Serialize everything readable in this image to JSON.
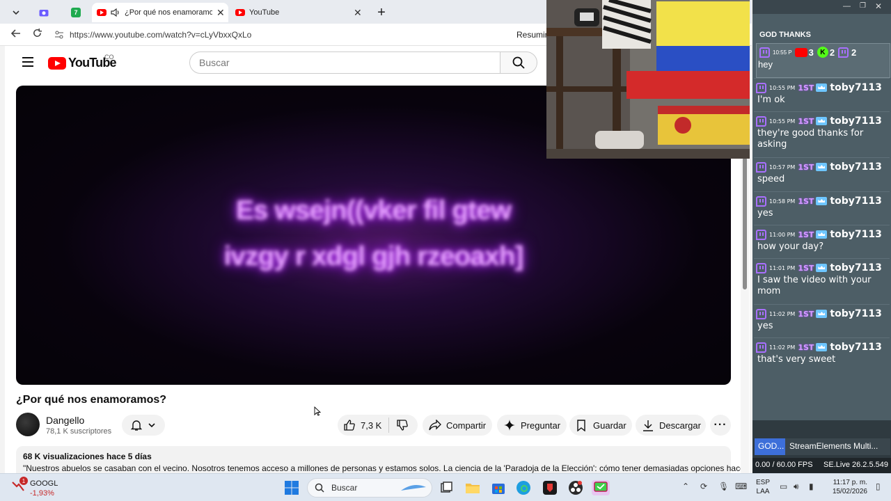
{
  "browser": {
    "tabs": [
      {
        "label": "¿Por qué nos enamoramos?",
        "active": true
      },
      {
        "label": "YouTube",
        "active": false
      }
    ],
    "badge_count": "7",
    "url": "https://www.youtube.com/watch?v=cLyVbxxQxLo",
    "summarize_label": "Resumir"
  },
  "youtube": {
    "logo_text": "YouTube",
    "country_code": "CO",
    "search_placeholder": "Buscar",
    "player_text_line1": "Es wsejn((vker fil gtew",
    "player_text_line2": "ivzgy r xdgl gjh rzeoaxh]",
    "video_title": "¿Por qué nos enamoramos?",
    "channel": {
      "name": "Dangello",
      "subscribers": "78,1 K suscriptores"
    },
    "actions": {
      "likes": "7,3 K",
      "share": "Compartir",
      "ask": "Preguntar",
      "save": "Guardar",
      "download": "Descargar"
    },
    "description": {
      "meta": "68 K visualizaciones  hace 5 días",
      "text": "\"Nuestros abuelos se casaban con el vecino. Nosotros tenemos acceso a millones de personas y estamos solos. La ciencia de la 'Paradoja de la Elección': cómo tener demasiadas opciones hace"
    }
  },
  "chat": {
    "header": "GOD THANKS",
    "first": {
      "time": "10:55 P",
      "text": "hey",
      "counts": [
        "3",
        "2",
        "2"
      ]
    },
    "messages": [
      {
        "time": "10:55 PM",
        "badge": "1ST",
        "user": "toby7113",
        "text": "I'm ok"
      },
      {
        "time": "10:55 PM",
        "badge": "1ST",
        "user": "toby7113",
        "text": "they're good thanks for asking"
      },
      {
        "time": "10:57 PM",
        "badge": "1ST",
        "user": "toby7113",
        "text": "speed"
      },
      {
        "time": "10:58 PM",
        "badge": "1ST",
        "user": "toby7113",
        "text": "yes"
      },
      {
        "time": "11:00 PM",
        "badge": "1ST",
        "user": "toby7113",
        "text": "how your day?"
      },
      {
        "time": "11:01 PM",
        "badge": "1ST",
        "user": "toby7113",
        "text": "I saw the video with your mom"
      },
      {
        "time": "11:02 PM",
        "badge": "1ST",
        "user": "toby7113",
        "text": "yes"
      },
      {
        "time": "11:02 PM",
        "badge": "1ST",
        "user": "toby7113",
        "text": "that's very sweet"
      }
    ],
    "tabs": [
      "GOD...",
      "StreamElements Multi..."
    ],
    "fps": "0.00 / 60.00 FPS",
    "version": "SE.Live 26.2.5.549"
  },
  "taskbar": {
    "stock_name": "GOOGL",
    "stock_change": "-1,93%",
    "stock_badge": "1",
    "search_label": "Buscar",
    "lang1": "ESP",
    "lang2": "LAA",
    "time": "11:17 p. m.",
    "date": "15/02/2026"
  },
  "colors": {
    "youtube_red": "#ff0000",
    "twitch_purple": "#a970ff",
    "chat_bg": "#4d5e66",
    "first_badge": "#d59cff"
  }
}
